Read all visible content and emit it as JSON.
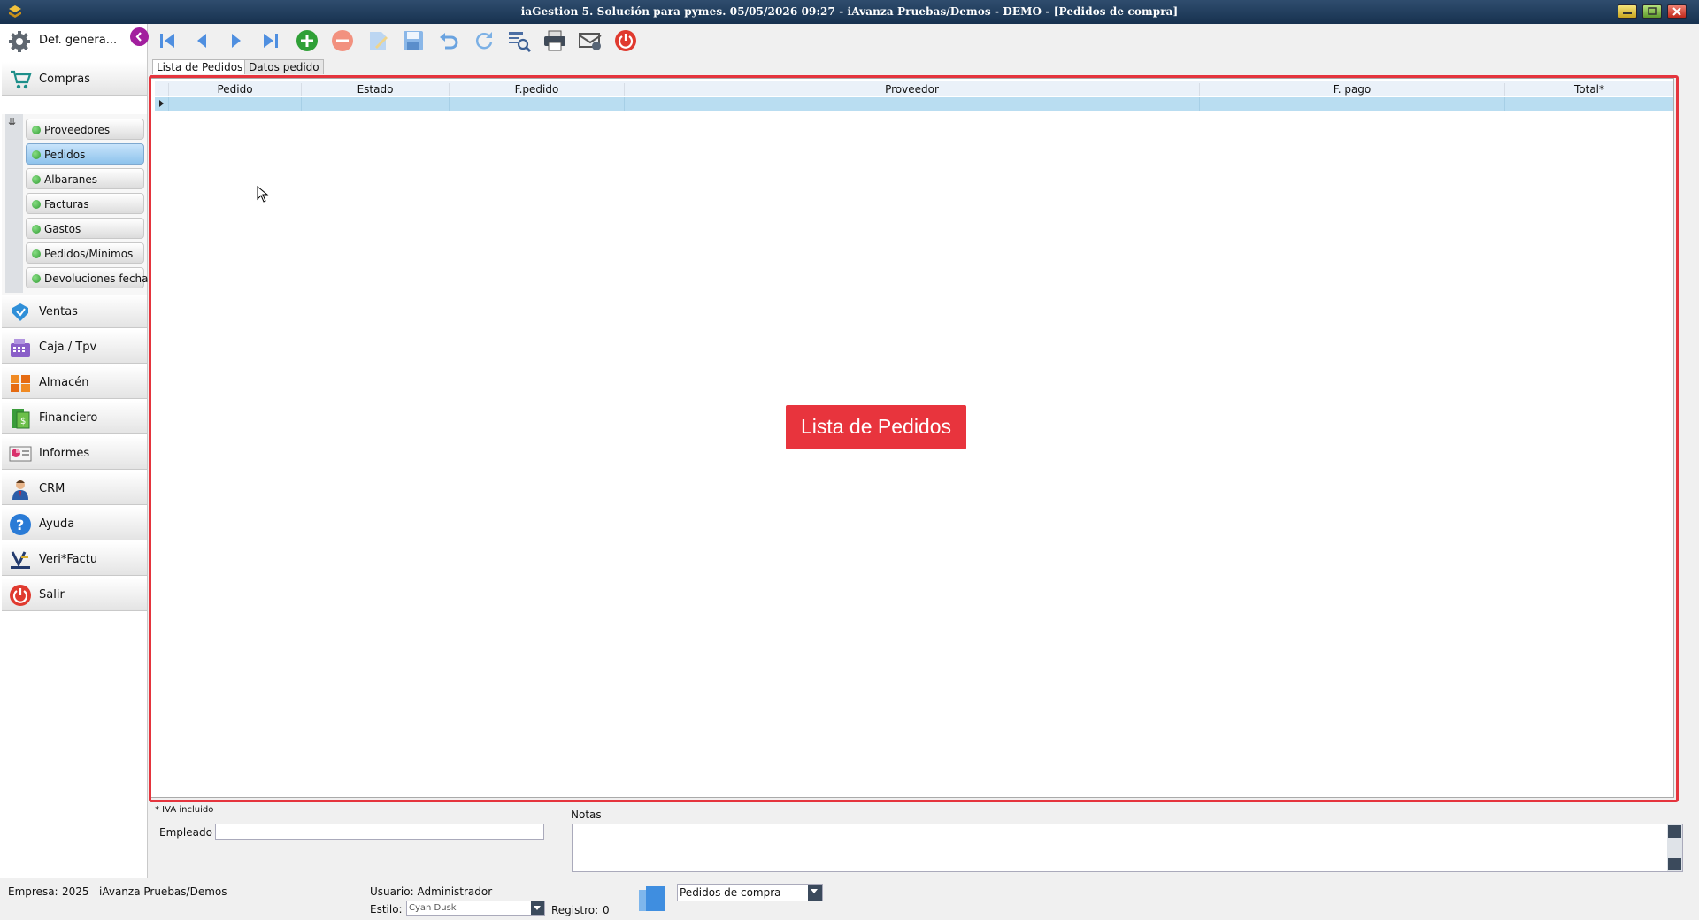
{
  "window": {
    "title": "iaGestion 5. Solución para pymes.   05/05/2026 09:27   -   iAvanza Pruebas/Demos - DEMO - [Pedidos de compra]"
  },
  "sidebar": {
    "top_label": "Def. genera...",
    "sections": [
      {
        "label": "Compras",
        "icon": "cart-icon"
      },
      {
        "label": "Ventas",
        "icon": "sales-icon"
      },
      {
        "label": "Caja / Tpv",
        "icon": "cash-register-icon"
      },
      {
        "label": "Almacén",
        "icon": "warehouse-icon"
      },
      {
        "label": "Financiero",
        "icon": "money-icon"
      },
      {
        "label": "Informes",
        "icon": "reports-icon"
      },
      {
        "label": "CRM",
        "icon": "crm-icon"
      },
      {
        "label": "Ayuda",
        "icon": "help-icon"
      },
      {
        "label": "Veri*Factu",
        "icon": "verifactu-icon"
      },
      {
        "label": "Salir",
        "icon": "power-icon"
      }
    ],
    "subitems": [
      {
        "label": "Proveedores",
        "active": false
      },
      {
        "label": "Pedidos",
        "active": true
      },
      {
        "label": "Albaranes",
        "active": false
      },
      {
        "label": "Facturas",
        "active": false
      },
      {
        "label": "Gastos",
        "active": false
      },
      {
        "label": "Pedidos/Mínimos",
        "active": false
      },
      {
        "label": "Devoluciones fecha",
        "active": false
      }
    ]
  },
  "toolbar": {
    "icons": [
      "first-record-icon",
      "previous-record-icon",
      "next-record-icon",
      "last-record-icon",
      "add-icon",
      "delete-icon",
      "edit-icon",
      "save-icon",
      "undo-icon",
      "refresh-icon",
      "search-list-icon",
      "print-icon",
      "tools-icon",
      "exit-icon"
    ]
  },
  "tabs": {
    "list": "Lista de Pedidos",
    "detail": "Datos pedido"
  },
  "grid": {
    "columns": [
      "Pedido",
      "Estado",
      "F.pedido",
      "Proveedor",
      "F. pago",
      "Total*"
    ]
  },
  "callout": "Lista de Pedidos",
  "form": {
    "iva_note": "* IVA incluido",
    "empleado_label": "Empleado",
    "empleado_value": "",
    "notas_label": "Notas",
    "notas_value": ""
  },
  "status": {
    "empresa_label": "Empresa:",
    "empresa_year": "2025",
    "empresa_name": "iAvanza Pruebas/Demos",
    "usuario": "Usuario: Administrador",
    "estilo_label": "Estilo:",
    "estilo_value": "Cyan Dusk",
    "registro_label": "Registro:",
    "registro_value": "0",
    "module": "Pedidos de compra"
  },
  "colors": {
    "accent_red": "#e5343d",
    "active_item": "#8ec3ec",
    "title_bar": "#17314f"
  }
}
